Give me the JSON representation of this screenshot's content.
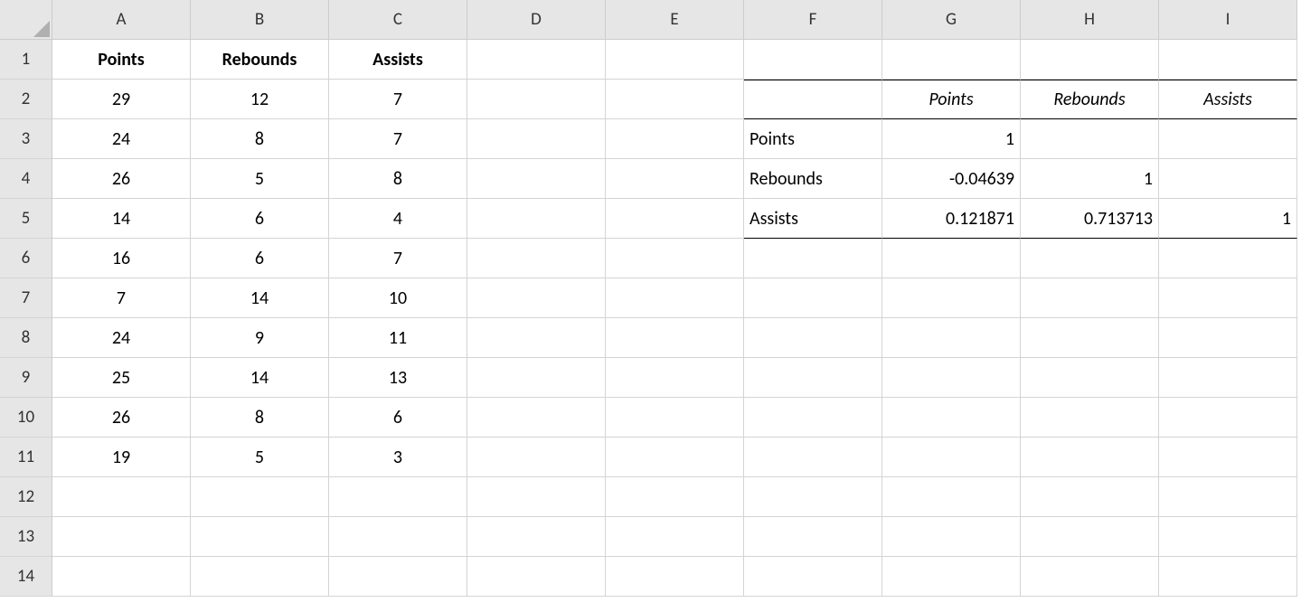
{
  "columns": [
    "A",
    "B",
    "C",
    "D",
    "E",
    "F",
    "G",
    "H",
    "I"
  ],
  "rows": [
    "1",
    "2",
    "3",
    "4",
    "5",
    "6",
    "7",
    "8",
    "9",
    "10",
    "11",
    "12",
    "13",
    "14"
  ],
  "main": {
    "headers": {
      "a": "Points",
      "b": "Rebounds",
      "c": "Assists"
    },
    "data": [
      {
        "a": "29",
        "b": "12",
        "c": "7"
      },
      {
        "a": "24",
        "b": "8",
        "c": "7"
      },
      {
        "a": "26",
        "b": "5",
        "c": "8"
      },
      {
        "a": "14",
        "b": "6",
        "c": "4"
      },
      {
        "a": "16",
        "b": "6",
        "c": "7"
      },
      {
        "a": "7",
        "b": "14",
        "c": "10"
      },
      {
        "a": "24",
        "b": "9",
        "c": "11"
      },
      {
        "a": "25",
        "b": "14",
        "c": "13"
      },
      {
        "a": "26",
        "b": "8",
        "c": "6"
      },
      {
        "a": "19",
        "b": "5",
        "c": "3"
      }
    ]
  },
  "corr": {
    "col_headers": {
      "g": "Points",
      "h": "Rebounds",
      "i": "Assists"
    },
    "rows": [
      {
        "label": "Points",
        "g": "1",
        "h": "",
        "i": ""
      },
      {
        "label": "Rebounds",
        "g": "-0.04639",
        "h": "1",
        "i": ""
      },
      {
        "label": "Assists",
        "g": "0.121871",
        "h": "0.713713",
        "i": "1"
      }
    ]
  }
}
